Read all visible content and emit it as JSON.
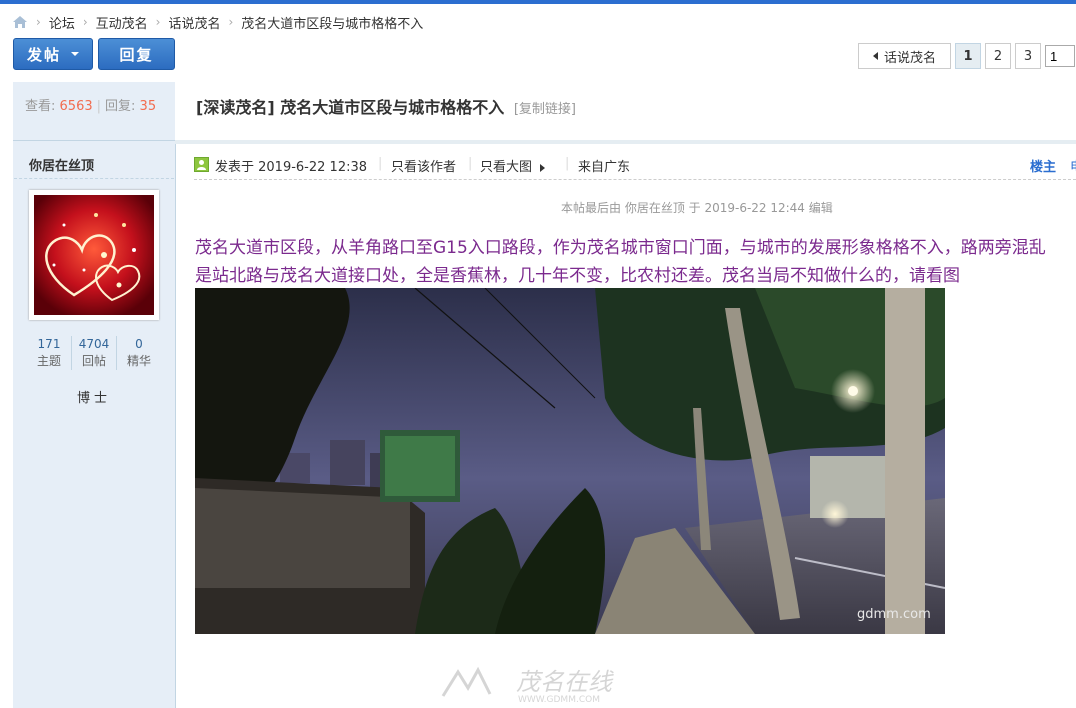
{
  "breadcrumb": {
    "items": [
      "论坛",
      "互动茂名",
      "话说茂名",
      "茂名大道市区段与城市格格不入"
    ]
  },
  "toolbar": {
    "post_label": "发帖",
    "reply_label": "回复"
  },
  "pagination": {
    "back_label": "话说茂名",
    "pages": [
      "1",
      "2",
      "3"
    ],
    "current_page": "1",
    "jump_value": "1"
  },
  "thread_stats": {
    "views_label": "查看:",
    "views": "6563",
    "replies_label": "回复:",
    "replies": "35"
  },
  "thread": {
    "category": "[深读茂名]",
    "title": "茂名大道市区段与城市格格不入",
    "copy_link": "[复制链接]"
  },
  "author": {
    "name": "你居在丝顶",
    "stats": [
      {
        "value": "171",
        "label": "主题"
      },
      {
        "value": "4704",
        "label": "回帖"
      },
      {
        "value": "0",
        "label": "精华"
      }
    ],
    "rank": "博士"
  },
  "post": {
    "posted_at": "发表于 2019-6-22 12:38",
    "only_author": "只看该作者",
    "large_image": "只看大图",
    "from": "来自广东",
    "floor": "楼主",
    "floor_extra": "电",
    "edit_note": "本帖最后由 你居在丝顶 于 2019-6-22 12:44 编辑",
    "line1": "茂名大道市区段，从羊角路口至G15入口路段，作为茂名城市窗口门面，与城市的发展形象格格不入，路两旁混乱",
    "line2": "是站北路与茂名大道接口处，全是香蕉林，几十年不变，比农村还差。茂名当局不知做什么的，请看图",
    "image_watermark": "gdmm.com"
  },
  "watermark": {
    "text": "茂名在线",
    "subtext": "WWW.GDMM.COM"
  },
  "colors": {
    "accent": "#2b6ed0",
    "sidebar_bg": "#e6eef7",
    "post_text": "#7b2a8e",
    "stat_number": "#f26c4f"
  },
  "icons": [
    "home-icon",
    "caret-down-icon",
    "chevron-left-icon",
    "online-status-icon",
    "triangle-right-icon"
  ]
}
